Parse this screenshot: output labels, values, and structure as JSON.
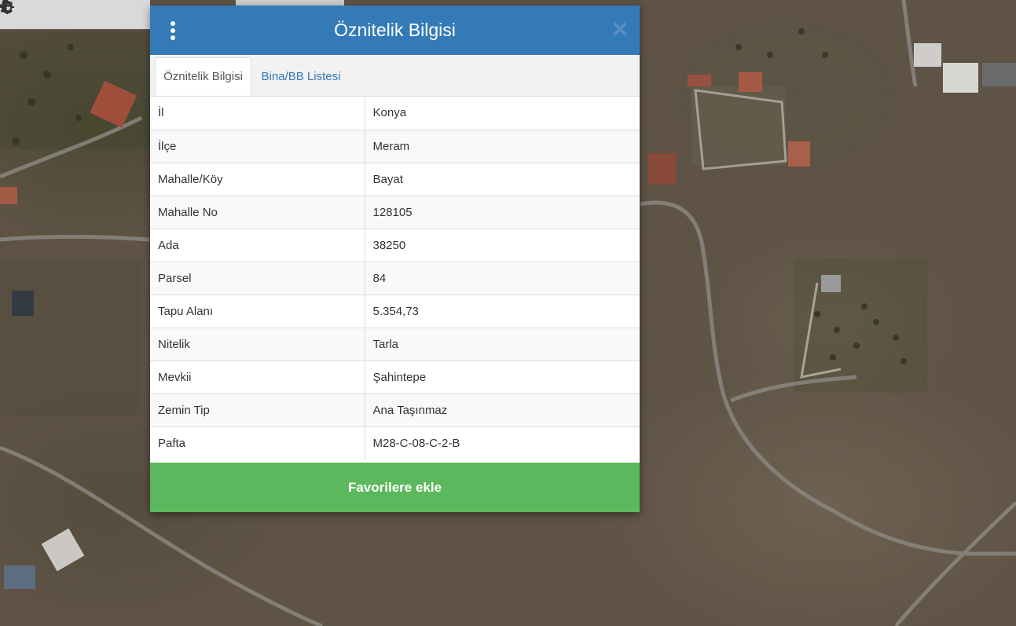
{
  "map": {
    "toolbar": {
      "tools": [
        {
          "name": "zoom-in",
          "icon": "plus-icon"
        },
        {
          "name": "zoom-out",
          "icon": "minus-icon"
        },
        {
          "name": "refresh",
          "icon": "refresh-icon"
        },
        {
          "name": "locate",
          "icon": "crosshair-icon"
        },
        {
          "name": "info",
          "icon": "info-icon"
        }
      ]
    }
  },
  "modal": {
    "title": "Öznitelik Bilgisi",
    "menu_icon": "vertical-dots-icon",
    "close_icon": "close-icon",
    "header_color": "#337ab7",
    "tabs": [
      {
        "label": "Öznitelik Bilgisi",
        "active": true
      },
      {
        "label": "Bina/BB Listesi",
        "active": false
      }
    ],
    "attributes": [
      {
        "key": "İl",
        "value": "Konya"
      },
      {
        "key": "İlçe",
        "value": "Meram"
      },
      {
        "key": "Mahalle/Köy",
        "value": "Bayat"
      },
      {
        "key": "Mahalle No",
        "value": "128105"
      },
      {
        "key": "Ada",
        "value": "38250"
      },
      {
        "key": "Parsel",
        "value": "84"
      },
      {
        "key": "Tapu Alanı",
        "value": "5.354,73"
      },
      {
        "key": "Nitelik",
        "value": "Tarla"
      },
      {
        "key": "Mevkii",
        "value": "Şahintepe"
      },
      {
        "key": "Zemin Tip",
        "value": "Ana Taşınmaz"
      },
      {
        "key": "Pafta",
        "value": "M28-C-08-C-2-B"
      }
    ],
    "favorite_button": {
      "label": "Favorilere ekle",
      "color": "#5cb85c"
    }
  }
}
